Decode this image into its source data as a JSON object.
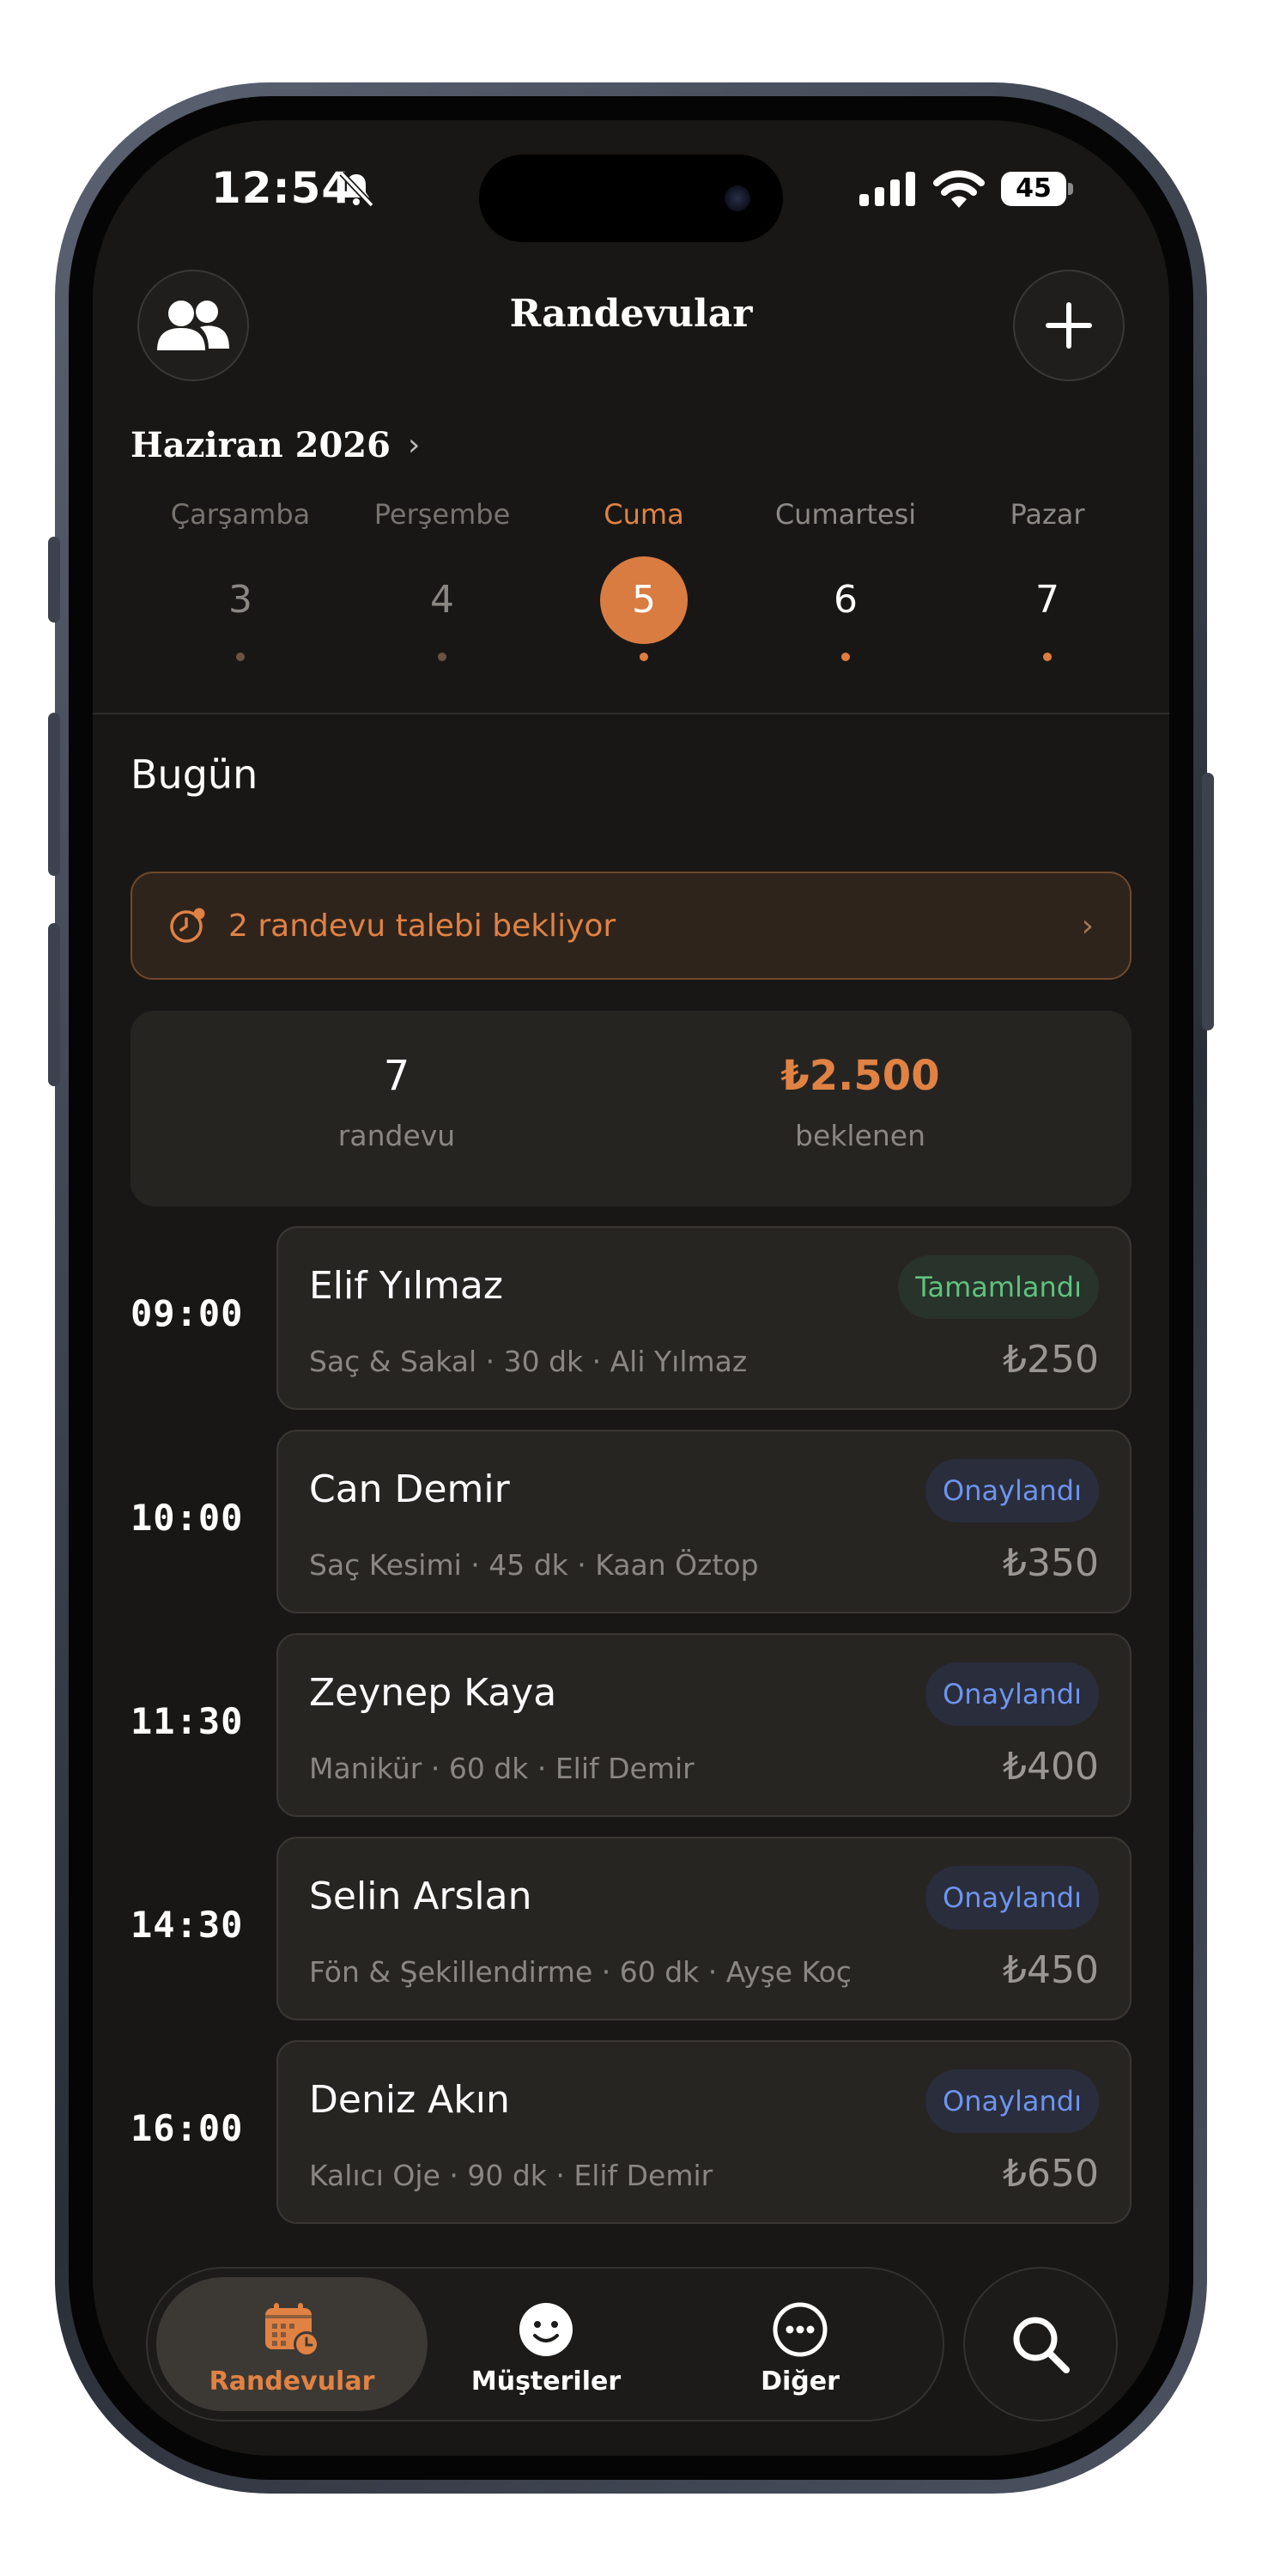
{
  "status_bar": {
    "time": "12:54",
    "battery": "45"
  },
  "header": {
    "title": "Randevular"
  },
  "calendar": {
    "month": "Haziran 2026",
    "days": [
      {
        "name": "Çarşamba",
        "number": "3",
        "state": "past"
      },
      {
        "name": "Perşembe",
        "number": "4",
        "state": "past"
      },
      {
        "name": "Cuma",
        "number": "5",
        "state": "selected"
      },
      {
        "name": "Cumartesi",
        "number": "6",
        "state": "future"
      },
      {
        "name": "Pazar",
        "number": "7",
        "state": "future"
      }
    ]
  },
  "section_title": "Bugün",
  "pending_banner": {
    "text": "2 randevu talebi bekliyor"
  },
  "stats": {
    "count": {
      "value": "7",
      "label": "randevu"
    },
    "expected": {
      "value": "₺2.500",
      "label": "beklenen"
    }
  },
  "appointments": [
    {
      "time": "09:00",
      "name": "Elif Yılmaz",
      "details": "Saç & Sakal · 30 dk · Ali Yılmaz",
      "status": "Tamamlandı",
      "price": "₺250"
    },
    {
      "time": "10:00",
      "name": "Can Demir",
      "details": "Saç Kesimi · 45 dk · Kaan Öztop",
      "status": "Onaylandı",
      "price": "₺350"
    },
    {
      "time": "11:30",
      "name": "Zeynep Kaya",
      "details": "Manikür · 60 dk · Elif Demir",
      "status": "Onaylandı",
      "price": "₺400"
    },
    {
      "time": "14:30",
      "name": "Selin Arslan",
      "details": "Fön & Şekillendirme · 60 dk · Ayşe Koç",
      "status": "Onaylandı",
      "price": "₺450"
    },
    {
      "time": "16:00",
      "name": "Deniz Akın",
      "details": "Kalıcı Oje · 90 dk · Elif Demir",
      "status": "Onaylandı",
      "price": "₺650"
    }
  ],
  "tab_bar": {
    "tabs": [
      {
        "label": "Randevular",
        "icon": "calendar-clock-icon",
        "active": true
      },
      {
        "label": "Müşteriler",
        "icon": "smiley-icon",
        "active": false
      },
      {
        "label": "Diğer",
        "icon": "more-icon",
        "active": false
      }
    ]
  },
  "colors": {
    "accent": "#E08244",
    "background": "#181715",
    "completed": "#5FC27E",
    "confirmed": "#6D94EF"
  }
}
